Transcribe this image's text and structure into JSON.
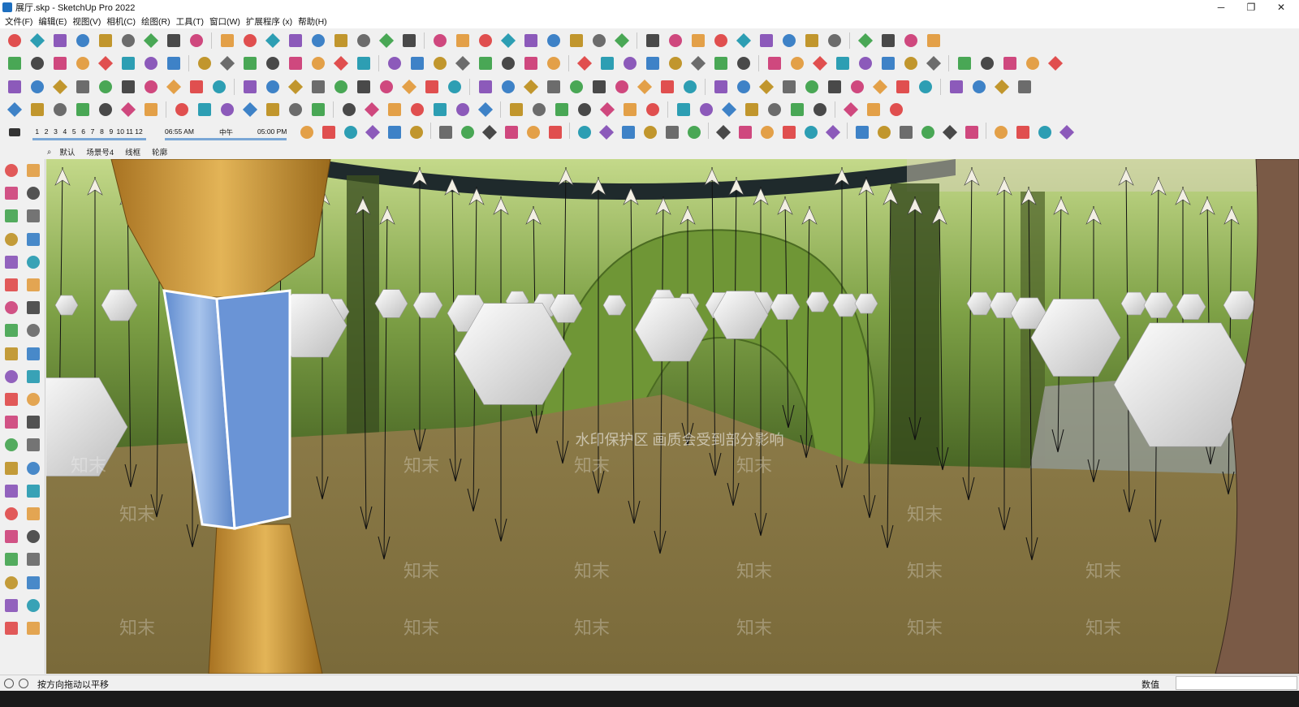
{
  "window": {
    "title": "展厅.skp - SketchUp Pro 2022",
    "controls": [
      "─",
      "❐",
      "✕"
    ]
  },
  "menu": [
    "文件(F)",
    "编辑(E)",
    "视图(V)",
    "相机(C)",
    "绘图(R)",
    "工具(T)",
    "窗口(W)",
    "扩展程序 (x)",
    "帮助(H)"
  ],
  "shadow_bar": {
    "months": [
      "1",
      "2",
      "3",
      "4",
      "5",
      "6",
      "7",
      "8",
      "9",
      "10",
      "11",
      "12"
    ],
    "time_start": "06:55 AM",
    "time_mid": "中午",
    "time_end": "05:00 PM"
  },
  "scene_tabs": [
    "默认",
    "场景号4",
    "线框",
    "轮廓"
  ],
  "viewport": {
    "watermark_main": "水印保护区   画质会受到部分影响",
    "watermark_tile": "知末"
  },
  "status": {
    "hint": "按方向拖动以平移",
    "measure_label": "数值",
    "measure_value": ""
  },
  "colors": {
    "ground": "#8a7a46",
    "forest_dark": "#3e5a1e",
    "forest_light": "#9ec25a",
    "column_gold": "#c99a3a",
    "glass_blue": "#7aa3dc",
    "hexagon": "#f2f2f2"
  }
}
